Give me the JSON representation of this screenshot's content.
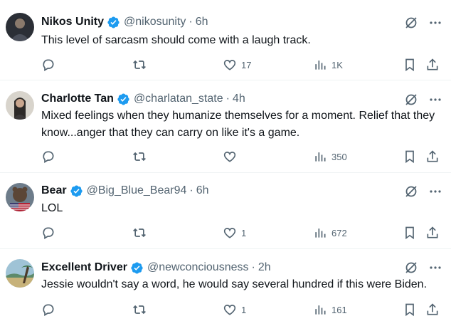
{
  "tweets": [
    {
      "name": "Nikos Unity",
      "handle": "@nikosunity",
      "time": "6h",
      "text": "This level of sarcasm should come with a laugh track.",
      "likes": "17",
      "views": "1K"
    },
    {
      "name": "Charlotte Tan",
      "handle": "@charlatan_state",
      "time": "4h",
      "text": "Mixed feelings when they humanize themselves for a moment. Relief that they know...anger that they can carry on like it's a game.",
      "likes": "",
      "views": "350"
    },
    {
      "name": "Bear",
      "handle": "@Big_Blue_Bear94",
      "time": "6h",
      "text": "LOL",
      "likes": "1",
      "views": "672"
    },
    {
      "name": "Excellent Driver",
      "handle": "@newconciousness",
      "time": "2h",
      "text": "Jessie wouldn't say a word, he would say several hundred if this were Biden.",
      "likes": "1",
      "views": "161"
    }
  ],
  "separator": "·",
  "colors": {
    "verified": "#1d9bf0",
    "secondary_text": "#536471",
    "primary_text": "#0f1419",
    "divider": "#eff3f4"
  },
  "icons": {
    "verified": "verified-badge-icon",
    "grok": "grok-icon",
    "more": "more-dots-icon",
    "reply": "reply-icon",
    "retweet": "retweet-icon",
    "like": "heart-icon",
    "views": "views-chart-icon",
    "bookmark": "bookmark-icon",
    "share": "share-icon"
  }
}
